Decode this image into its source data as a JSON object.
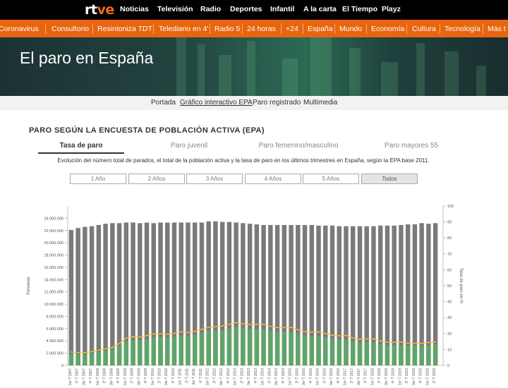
{
  "top_nav": {
    "logo": {
      "part1": "rt",
      "part2": "ve"
    },
    "items": [
      "Noticias",
      "Televisión",
      "Radio",
      "Deportes",
      "Infantil",
      "A la carta",
      "El Tiempo",
      "Playz"
    ]
  },
  "sub_nav": {
    "items": [
      "Coronavirus",
      "Consultorio",
      "Resintoniza TDT",
      "Telediario en 4'",
      "Radio 5",
      "24 horas",
      "+24",
      "España",
      "Mundo",
      "Economía",
      "Cultura",
      "Tecnología",
      "Más t"
    ]
  },
  "banner": {
    "title": "El paro en España"
  },
  "section_nav": {
    "items": [
      "Portada",
      "Gráfico interactivo EPA",
      "Paro registrado",
      "Multimedia"
    ],
    "active_index": 1
  },
  "section_title": "PARO SEGÚN LA ENCUESTA DE POBLACIÓN ACTIVA (EPA)",
  "tabs": [
    "Tasa de paro",
    "Paro juvenil",
    "Paro femenino/masculino",
    "Paro mayores 55"
  ],
  "active_tab": 0,
  "description": "Evolución del número total de parados, el total de la población activa y la tasa de paro en los últimos trimestres en España, según la EPA base 2011.",
  "range_buttons": [
    "1 Año",
    "2 Años",
    "3 Años",
    "4 Años",
    "5 Años",
    "Todos"
  ],
  "active_range": 5,
  "colors": {
    "nav_bg": "#000000",
    "brand_orange": "#e8650f",
    "active_population_bar": "#7a7a7a",
    "unemployed_bar": "#5fa468",
    "rate_line": "#f2c230"
  },
  "chart_data": {
    "type": "bar",
    "categories": [
      "1er T 2007",
      "2º T 2007",
      "3er T 2007",
      "4º T 2007",
      "1er T 2008",
      "2º T 2008",
      "3er T 2008",
      "4º T 2008",
      "1er T 2009",
      "2º T 2009",
      "3er T 2009",
      "4º T 2009",
      "1er T 2010",
      "2º T 2010",
      "3er T 2010",
      "4º T 2010",
      "1er T 2011",
      "2º T 2011",
      "3er T 2011",
      "4º T 2011",
      "1er T 2012",
      "2º T 2012",
      "3er T 2012",
      "4º T 2012",
      "1er T 2013",
      "2º T 2013",
      "3er T 2013",
      "4º T 2013",
      "1er T 2014",
      "2º T 2014",
      "3er T 2014",
      "4º T 2014",
      "1er T 2015",
      "2º T 2015",
      "3er T 2015",
      "4º T 2015",
      "1er T 2016",
      "2º T 2016",
      "3er T 2016",
      "4º T 2016",
      "1er T 2017",
      "2º T 2017",
      "3er T 2017",
      "4º T 2017",
      "1er T 2018",
      "2º T 2018",
      "3er T 2018",
      "4º T 2018",
      "1er T 2019",
      "2º T 2019",
      "3er T 2019",
      "4º T 2019",
      "1er T 2020",
      "2º T 2020"
    ],
    "series": [
      {
        "axis": "left",
        "values": [
          22100000,
          22400000,
          22600000,
          22700000,
          22900000,
          23100000,
          23200000,
          23200000,
          23300000,
          23300000,
          23200000,
          23300000,
          23200000,
          23300000,
          23300000,
          23300000,
          23300000,
          23300000,
          23300000,
          23300000,
          23500000,
          23500000,
          23400000,
          23400000,
          23300000,
          23200000,
          23100000,
          23000000,
          22900000,
          22900000,
          22900000,
          22900000,
          22900000,
          22900000,
          22900000,
          22900000,
          22800000,
          22800000,
          22800000,
          22700000,
          22700000,
          22700000,
          22700000,
          22700000,
          22700000,
          22800000,
          22800000,
          22800000,
          22900000,
          23000000,
          23000000,
          23200000,
          23100000,
          23200000
        ]
      },
      {
        "axis": "left",
        "values": [
          1850000,
          1800000,
          1780000,
          1930000,
          2170000,
          2380000,
          2600000,
          3200000,
          4000000,
          4130000,
          4100000,
          4300000,
          4600000,
          4630000,
          4570000,
          4700000,
          4900000,
          4830000,
          4980000,
          5270000,
          5640000,
          5690000,
          5780000,
          5970000,
          6280000,
          6050000,
          5940000,
          5900000,
          5930000,
          5620000,
          5430000,
          5460000,
          5440000,
          5150000,
          4850000,
          4780000,
          4790000,
          4570000,
          4320000,
          4240000,
          4250000,
          3920000,
          3730000,
          3770000,
          3800000,
          3500000,
          3330000,
          3300000,
          3350000,
          3230000,
          3220000,
          3190000,
          3310000,
          3370000
        ]
      },
      {
        "axis": "right",
        "values": [
          8.4,
          8.0,
          8.0,
          8.6,
          9.6,
          10.4,
          11.3,
          13.8,
          17.2,
          17.9,
          17.8,
          18.7,
          19.8,
          19.9,
          19.6,
          20.1,
          21.0,
          20.7,
          21.4,
          22.6,
          24.0,
          24.3,
          24.8,
          25.8,
          26.9,
          26.1,
          25.7,
          25.7,
          25.9,
          24.5,
          23.7,
          23.7,
          23.8,
          22.4,
          21.2,
          20.9,
          21.0,
          20.0,
          18.9,
          18.6,
          18.8,
          17.2,
          16.4,
          16.6,
          16.7,
          15.3,
          14.6,
          14.5,
          14.7,
          14.0,
          13.9,
          13.8,
          14.4,
          14.5
        ]
      }
    ],
    "y_left": {
      "label": "Personas",
      "ticks": [
        "0",
        "2.000.000",
        "4.000.000",
        "6.000.000",
        "8.000.000",
        "10.000.000",
        "12.000.000",
        "14.000.000",
        "16.000.000",
        "18.000.000",
        "20.000.000",
        "22.000.000",
        "24.000.000"
      ],
      "range": [
        0,
        26000000
      ]
    },
    "y_right": {
      "label": "Tasa de paro en %",
      "ticks": [
        "0",
        "10",
        "20",
        "30",
        "40",
        "50",
        "60",
        "70",
        "80",
        "90",
        "100"
      ],
      "range": [
        0,
        100
      ]
    },
    "grid": false
  }
}
